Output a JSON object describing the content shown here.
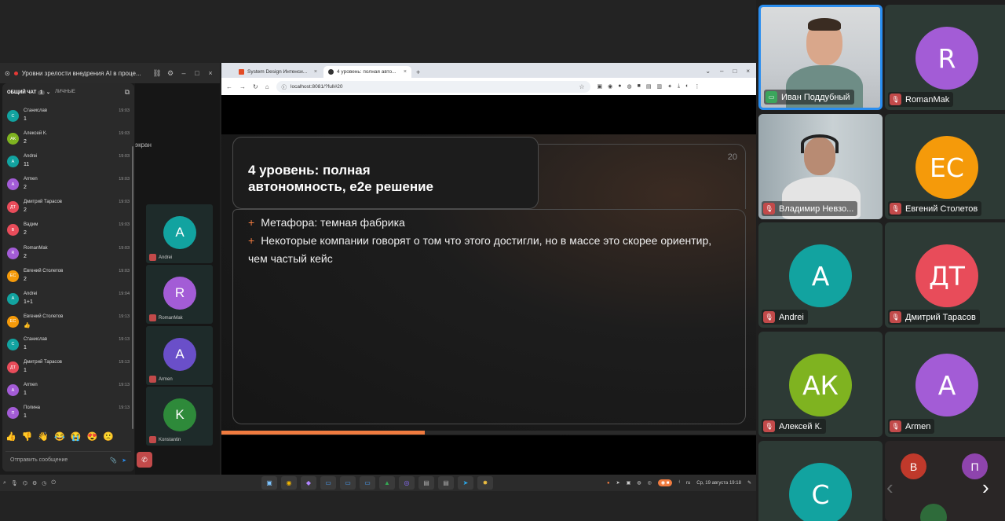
{
  "meeting_window": {
    "title": "Уровни зрелости внедрения AI в проце...",
    "background_label": "экран",
    "background_tiles": [
      {
        "initials": "A",
        "name": "Andrei",
        "color": "#12a3a0"
      },
      {
        "initials": "R",
        "name": "RomanMak",
        "color": "#a35cd6"
      },
      {
        "initials": "A",
        "name": "Armen",
        "color": "#6a4fc9"
      },
      {
        "initials": "K",
        "name": "Konstantin",
        "color": "#2e8a3a"
      }
    ]
  },
  "chat": {
    "tab_general": "ОБЩИЙ ЧАТ",
    "tab_general_count": "1",
    "tab_private": "ЛИЧНЫЕ",
    "input_placeholder": "Отправить сообщение",
    "emojis": [
      "👍",
      "👎",
      "👋",
      "😂",
      "😭",
      "😍",
      "🙁"
    ],
    "messages": [
      {
        "initials": "С",
        "color": "#12a3a0",
        "name": "Станислав",
        "time": "19:03",
        "text": "1"
      },
      {
        "initials": "АК",
        "color": "#7fb320",
        "name": "Алексей К.",
        "time": "19:03",
        "text": "2"
      },
      {
        "initials": "A",
        "color": "#12a3a0",
        "name": "Andrei",
        "time": "19:03",
        "text": "11"
      },
      {
        "initials": "A",
        "color": "#a35cd6",
        "name": "Armen",
        "time": "19:03",
        "text": "2"
      },
      {
        "initials": "ДТ",
        "color": "#e84c5a",
        "name": "Дмитрий Тарасов",
        "time": "19:03",
        "text": "2"
      },
      {
        "initials": "В",
        "color": "#e84c5a",
        "name": "Вадим",
        "time": "19:03",
        "text": "2"
      },
      {
        "initials": "R",
        "color": "#a35cd6",
        "name": "RomanMak",
        "time": "19:03",
        "text": "2"
      },
      {
        "initials": "ЕС",
        "color": "#f59a0a",
        "name": "Евгений Столетов",
        "time": "19:03",
        "text": "2"
      },
      {
        "initials": "A",
        "color": "#12a3a0",
        "name": "Andrei",
        "time": "19:04",
        "text": "1+1"
      },
      {
        "initials": "ЕС",
        "color": "#f59a0a",
        "name": "Евгений Столетов",
        "time": "19:13",
        "text": "👍"
      },
      {
        "initials": "С",
        "color": "#12a3a0",
        "name": "Станислав",
        "time": "19:13",
        "text": "1"
      },
      {
        "initials": "ДТ",
        "color": "#e84c5a",
        "name": "Дмитрий Тарасов",
        "time": "19:13",
        "text": "1"
      },
      {
        "initials": "A",
        "color": "#a35cd6",
        "name": "Armen",
        "time": "19:13",
        "text": "1"
      },
      {
        "initials": "П",
        "color": "#a35cd6",
        "name": "Полина",
        "time": "19:13",
        "text": "1"
      }
    ]
  },
  "browser": {
    "tab1": "System Design Интенси...",
    "tab2": "4 уровень: полная авто...",
    "url": "localhost:8081/?full#20"
  },
  "slide": {
    "title_line1": "4 уровень: полная",
    "title_line2": "автономность, e2e решение",
    "number": "20",
    "bullets": [
      "Метафора: темная фабрика",
      "Некоторые компании говорят о том что этого достигли, но в массе это скорее ориентир, чем частый кейс"
    ],
    "progress": 0.38
  },
  "taskbar": {
    "lang": "ru",
    "datetime": "Ср, 19 августа  19:18"
  },
  "participants": [
    {
      "name": "Иван Поддубный",
      "video": true,
      "mic": "screen"
    },
    {
      "name": "RomanMak",
      "initials": "R",
      "color": "#a35cd6",
      "mic": "muted"
    },
    {
      "name": "Владимир Невзо...",
      "video": true,
      "mic": "muted"
    },
    {
      "name": "Евгений Столетов",
      "initials": "ЕС",
      "color": "#f59a0a",
      "mic": "muted"
    },
    {
      "name": "Andrei",
      "initials": "A",
      "color": "#12a3a0",
      "mic": "muted"
    },
    {
      "name": "Дмитрий Тарасов",
      "initials": "ДТ",
      "color": "#e84c5a",
      "mic": "muted"
    },
    {
      "name": "Алексей К.",
      "initials": "АК",
      "color": "#7fb320",
      "mic": "muted"
    },
    {
      "name": "Armen",
      "initials": "A",
      "color": "#a35cd6",
      "mic": "muted"
    },
    {
      "name": "",
      "initials": "С",
      "color": "#12a3a0",
      "mic": "none"
    }
  ],
  "overflow_avatars": [
    {
      "initials": "В",
      "color": "#c0392b"
    },
    {
      "initials": "П",
      "color": "#8e44ad"
    }
  ]
}
